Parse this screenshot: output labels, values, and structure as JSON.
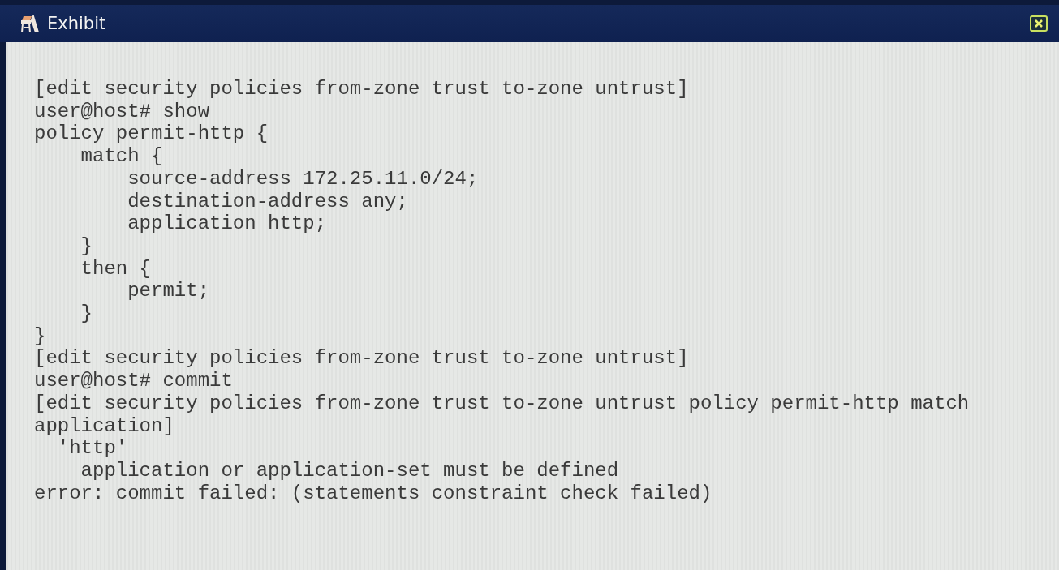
{
  "window": {
    "title": "Exhibit"
  },
  "terminal": {
    "lines": [
      "[edit security policies from-zone trust to-zone untrust]",
      "user@host# show",
      "policy permit-http {",
      "    match {",
      "        source-address 172.25.11.0/24;",
      "        destination-address any;",
      "        application http;",
      "    }",
      "    then {",
      "        permit;",
      "    }",
      "}",
      "[edit security policies from-zone trust to-zone untrust]",
      "user@host# commit",
      "[edit security policies from-zone trust to-zone untrust policy permit-http match",
      "application]",
      "  'http'",
      "    application or application-set must be defined",
      "error: commit failed: (statements constraint check failed)"
    ]
  }
}
